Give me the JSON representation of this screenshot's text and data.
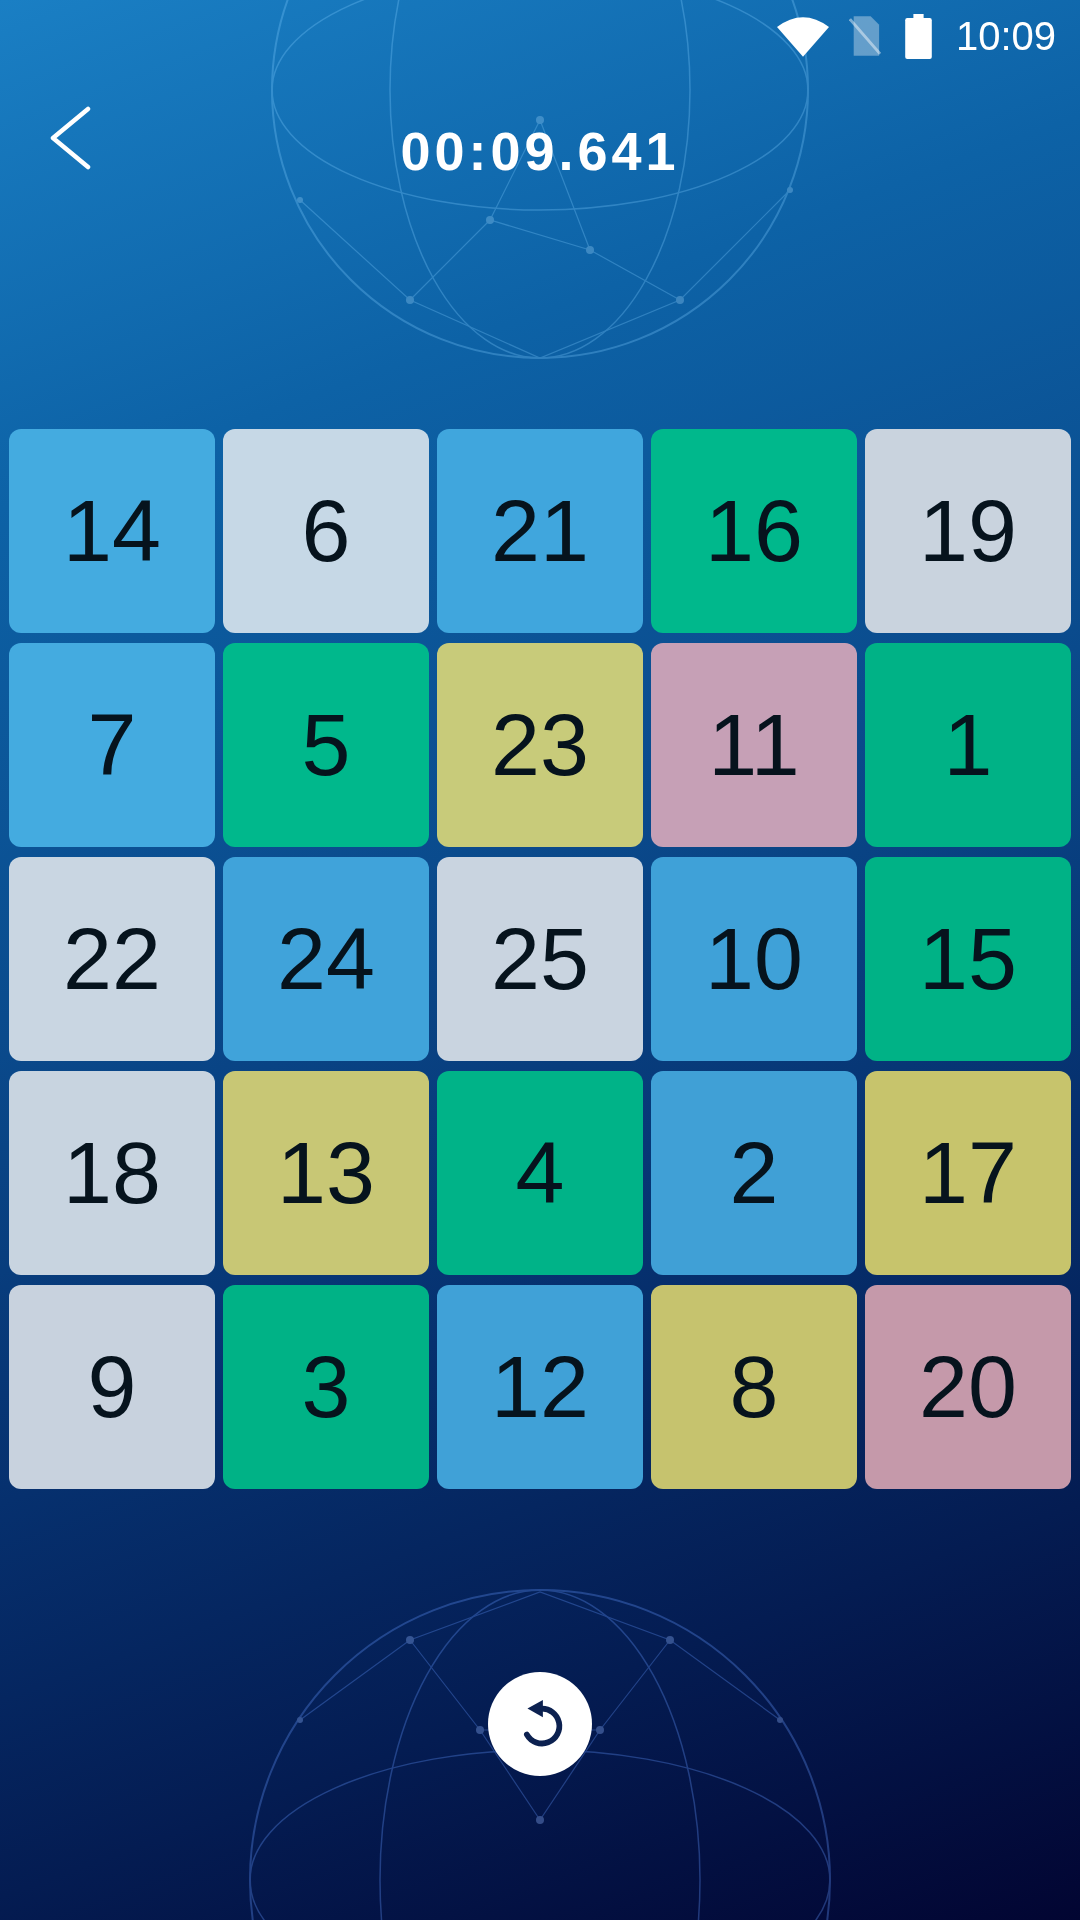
{
  "status_bar": {
    "time": "10:09"
  },
  "header": {
    "timer": "00:09.641"
  },
  "board": {
    "tiles": [
      {
        "number": "14",
        "color": "#44abe0"
      },
      {
        "number": "6",
        "color": "#c6d8e6"
      },
      {
        "number": "21",
        "color": "#40a6dd"
      },
      {
        "number": "16",
        "color": "#00b88c"
      },
      {
        "number": "19",
        "color": "#c9d3de"
      },
      {
        "number": "7",
        "color": "#44abe0"
      },
      {
        "number": "5",
        "color": "#00b88c"
      },
      {
        "number": "23",
        "color": "#c8cb7a"
      },
      {
        "number": "11",
        "color": "#c6a0b6"
      },
      {
        "number": "1",
        "color": "#00b286"
      },
      {
        "number": "22",
        "color": "#c9d6e2"
      },
      {
        "number": "24",
        "color": "#40a3da"
      },
      {
        "number": "25",
        "color": "#c9d4e0"
      },
      {
        "number": "10",
        "color": "#3fa1d8"
      },
      {
        "number": "15",
        "color": "#00b286"
      },
      {
        "number": "18",
        "color": "#c8d4e0"
      },
      {
        "number": "13",
        "color": "#c8c775"
      },
      {
        "number": "4",
        "color": "#00b388"
      },
      {
        "number": "2",
        "color": "#40a0d6"
      },
      {
        "number": "17",
        "color": "#c7c46c"
      },
      {
        "number": "9",
        "color": "#c8d2de"
      },
      {
        "number": "3",
        "color": "#00b286"
      },
      {
        "number": "12",
        "color": "#40a1d7"
      },
      {
        "number": "8",
        "color": "#c6c36e"
      },
      {
        "number": "20",
        "color": "#c599aa"
      }
    ]
  }
}
